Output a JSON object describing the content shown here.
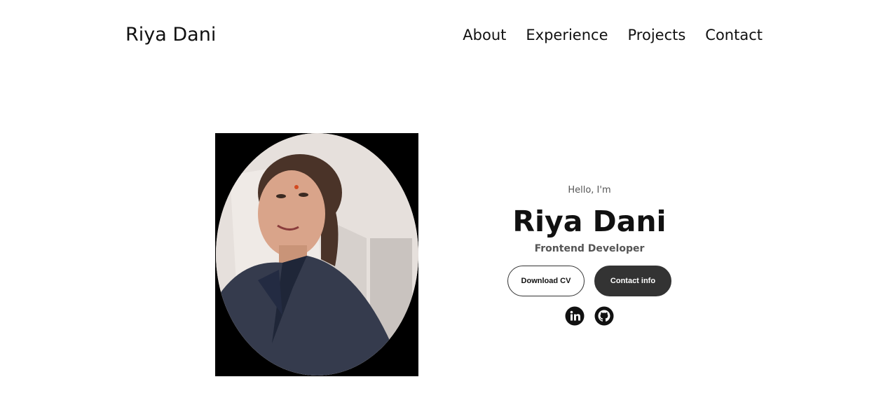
{
  "header": {
    "logo": "Riya Dani",
    "nav": [
      {
        "label": "About"
      },
      {
        "label": "Experience"
      },
      {
        "label": "Projects"
      },
      {
        "label": "Contact"
      }
    ]
  },
  "hero": {
    "greeting": "Hello, I'm",
    "name": "Riya Dani",
    "role": "Frontend Developer",
    "buttons": {
      "download_cv": "Download CV",
      "contact_info": "Contact info"
    },
    "social": [
      {
        "icon": "linkedin-icon"
      },
      {
        "icon": "github-icon"
      }
    ],
    "profile_picture": "profile-picture"
  },
  "colors": {
    "text": "#111111",
    "muted": "#555555",
    "button_dark": "#333333",
    "frame": "#000000"
  }
}
